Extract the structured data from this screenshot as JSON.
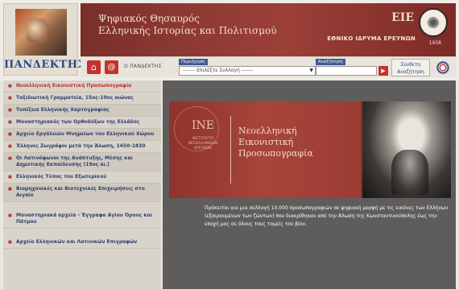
{
  "header": {
    "logo_text": "ΠΑΝΔΕΚΤΗΣ",
    "banner_title_line1": "Ψηφιακός Θησαυρός",
    "banner_title_line2": "Ελληνικής Ιστορίας και Πολιτισμού",
    "eie_mark": "ΕΙΕ",
    "eie_name": "ΕΘΝΙΚΟ ΙΔΡΥΜΑ ΕΡΕΥΝΩΝ",
    "seal_year": "1958"
  },
  "toolbar": {
    "home_icon": "home-icon",
    "mail_icon": "mail-icon",
    "pandektis_link": "Ο ΠΑΝΔΕΚΤΗΣ",
    "select_label": "Περιήγηση",
    "select_value": "------- Επιλέξτε Συλλογή -------",
    "search_label": "Αναζήτηση",
    "search_placeholder": "",
    "adv_search_line1": "Σύνθετη",
    "adv_search_line2": "Αναζήτηση",
    "flag_icon": "greek-flag-icon"
  },
  "sidebar": {
    "items": [
      {
        "label": "Νεοελληνική Εικονιστική Προσωπογραφία",
        "active": true
      },
      {
        "label": "Ταξιδιωτική Γραμματεία, 15ος-19ος αιώνας"
      },
      {
        "label": "Τοπίζεια Ελληνικής Χαρτογραφίας"
      },
      {
        "label": "Μοναστηριακός των Ορθοδόξων της Ελλάδος"
      },
      {
        "label": "Αρχείο Εργάλειών Μνημείων του Ελληνικού Χώρου"
      },
      {
        "label": "Έλληνες Ζωγράφοι μετά την Άλωση, 1450-1830"
      },
      {
        "label": "Οι Λατινόφωνοι της Ανάπτυξης, Μέσης και Δημοτικής Εκπαίδευσης (19ος αι.)"
      },
      {
        "label": "Ελληνικός Τύπος του Εξωτερικού"
      },
      {
        "label": "Βιομηχανικές και Βιοτεχνικές Επιχειρήσεις στο Αιγαίο"
      },
      {
        "label": "Μοναστηριακά αρχεία - Έγγραφα Αγίου Όρους και Πάτμου",
        "gap": true
      },
      {
        "label": "Αρχείο Ελληνικών και Λατινικών Επιγραφών",
        "gap": true
      }
    ]
  },
  "main": {
    "ine_mark": "ΙΝΕ",
    "ine_sub": "ΙΝΣΤΙΤΟΥΤΟ ΝΕΟΕΛΛΗΝΙΚΩΝ ΕΡΕΥΝΩΝ",
    "feature_title_1": "Νεοελληνική",
    "feature_title_2": "Εικονιστική",
    "feature_title_3": "Προσωπογραφία",
    "description": "Πρόκειται για μια συλλογή 10.000 προσωπογραφιών σε ψηφιακή μορφή με τις εικόνες των Ελλήνων (εξαιρουμένων των ζώντων) που διακρίθηκαν από την Άλωση της Κωνσταντινούπολης έως την εποχή μας σε όλους τους τομείς του βίου."
  }
}
